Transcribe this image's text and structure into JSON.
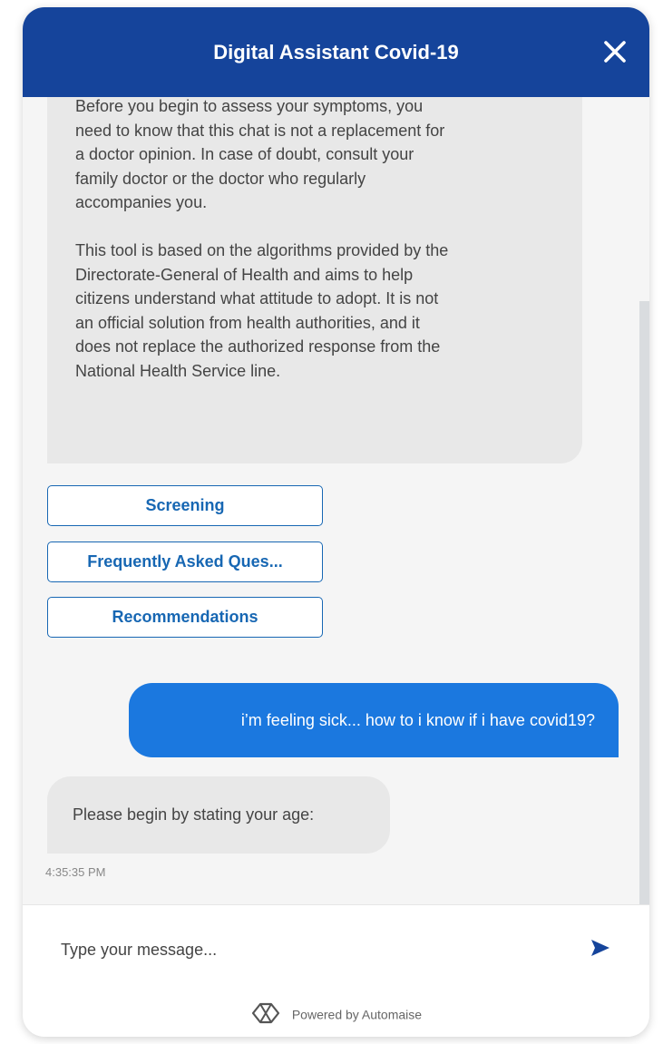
{
  "header": {
    "title": "Digital Assistant Covid-19",
    "close_icon": "close-icon"
  },
  "intro": {
    "paragraph1": "Before you begin to assess your symptoms, you\nneed to know that this chat is not a replacement for\na doctor opinion. In case of doubt, consult your\nfamily doctor or the doctor who regularly\naccompanies you.",
    "paragraph2": "This tool is based on the algorithms provided by the\nDirectorate-General of Health and aims to help\ncitizens understand what attitude to adopt. It is not\nan official solution from health authorities, and it\ndoes not replace the authorized response from the\nNational Health Service line."
  },
  "quick_replies": [
    "Screening",
    "Frequently Asked Ques...",
    "Recommendations"
  ],
  "messages": {
    "user": "i’m feeling sick... how to i know if i have covid19?",
    "bot": "Please begin by stating your age:",
    "timestamp": "4:35:35 PM"
  },
  "input": {
    "placeholder": "Type your message...",
    "value": "",
    "send_icon": "send-icon"
  },
  "footer": {
    "powered_by": "Powered by Automaise",
    "logo_icon": "automaise-logo-icon"
  },
  "colors": {
    "header": "#15449b",
    "accent": "#1767b3",
    "user_bubble": "#1b78df",
    "bot_bubble": "#e8e8e8",
    "chat_background": "#f5f5f5"
  }
}
